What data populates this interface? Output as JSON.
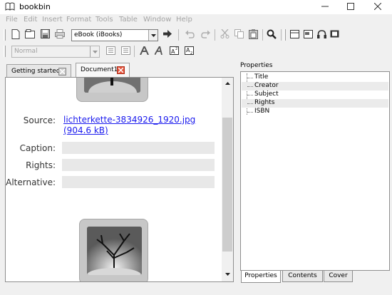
{
  "window": {
    "title": "bookbin",
    "controls": [
      "minimize-icon",
      "maximize-icon",
      "close-icon"
    ]
  },
  "menubar": {
    "items": [
      "File",
      "Edit",
      "Insert",
      "Format",
      "Tools",
      "Table",
      "Window",
      "Help"
    ]
  },
  "toolbar1": {
    "format_combo_value": "eBook (iBooks)",
    "icons": [
      "new-document-icon",
      "open-icon",
      "save-icon",
      "print-icon",
      "export-arrow-icon",
      "undo-icon",
      "redo-icon",
      "cut-icon",
      "copy-icon",
      "paste-icon",
      "find-icon",
      "layout-icon",
      "preview-icon",
      "audio-icon",
      "video-icon"
    ]
  },
  "toolbar2": {
    "style_combo_value": "Normal",
    "icons": [
      "bullet-list-icon",
      "numbered-list-icon",
      "font-a-icon",
      "italic-a-icon",
      "superscript-icon",
      "subscript-icon"
    ]
  },
  "tabs": [
    {
      "label": "Getting started",
      "active": false
    },
    {
      "label": "Document1",
      "active": true
    }
  ],
  "document": {
    "source_label": "Source:",
    "source_value": "lichterkette-3834926_1920.jpg (904.6 kB)",
    "caption_label": "Caption:",
    "rights_label": "Rights:",
    "alternative_label": "Alternative:",
    "caption_value": "",
    "rights_value": "",
    "alternative_value": ""
  },
  "properties": {
    "title": "Properties",
    "items": [
      {
        "label": "Title",
        "shaded": false
      },
      {
        "label": "Creator",
        "shaded": true
      },
      {
        "label": "Subject",
        "shaded": false
      },
      {
        "label": "Rights",
        "shaded": true
      },
      {
        "label": "ISBN",
        "shaded": false
      }
    ],
    "bottom_tabs": [
      {
        "label": "Properties",
        "active": true
      },
      {
        "label": "Contents",
        "active": false
      },
      {
        "label": "Cover",
        "active": false
      }
    ]
  },
  "colors": {
    "link": "#1a1aee",
    "field_bg": "#e8e8e8",
    "close_tab_red": "#e5563f"
  }
}
